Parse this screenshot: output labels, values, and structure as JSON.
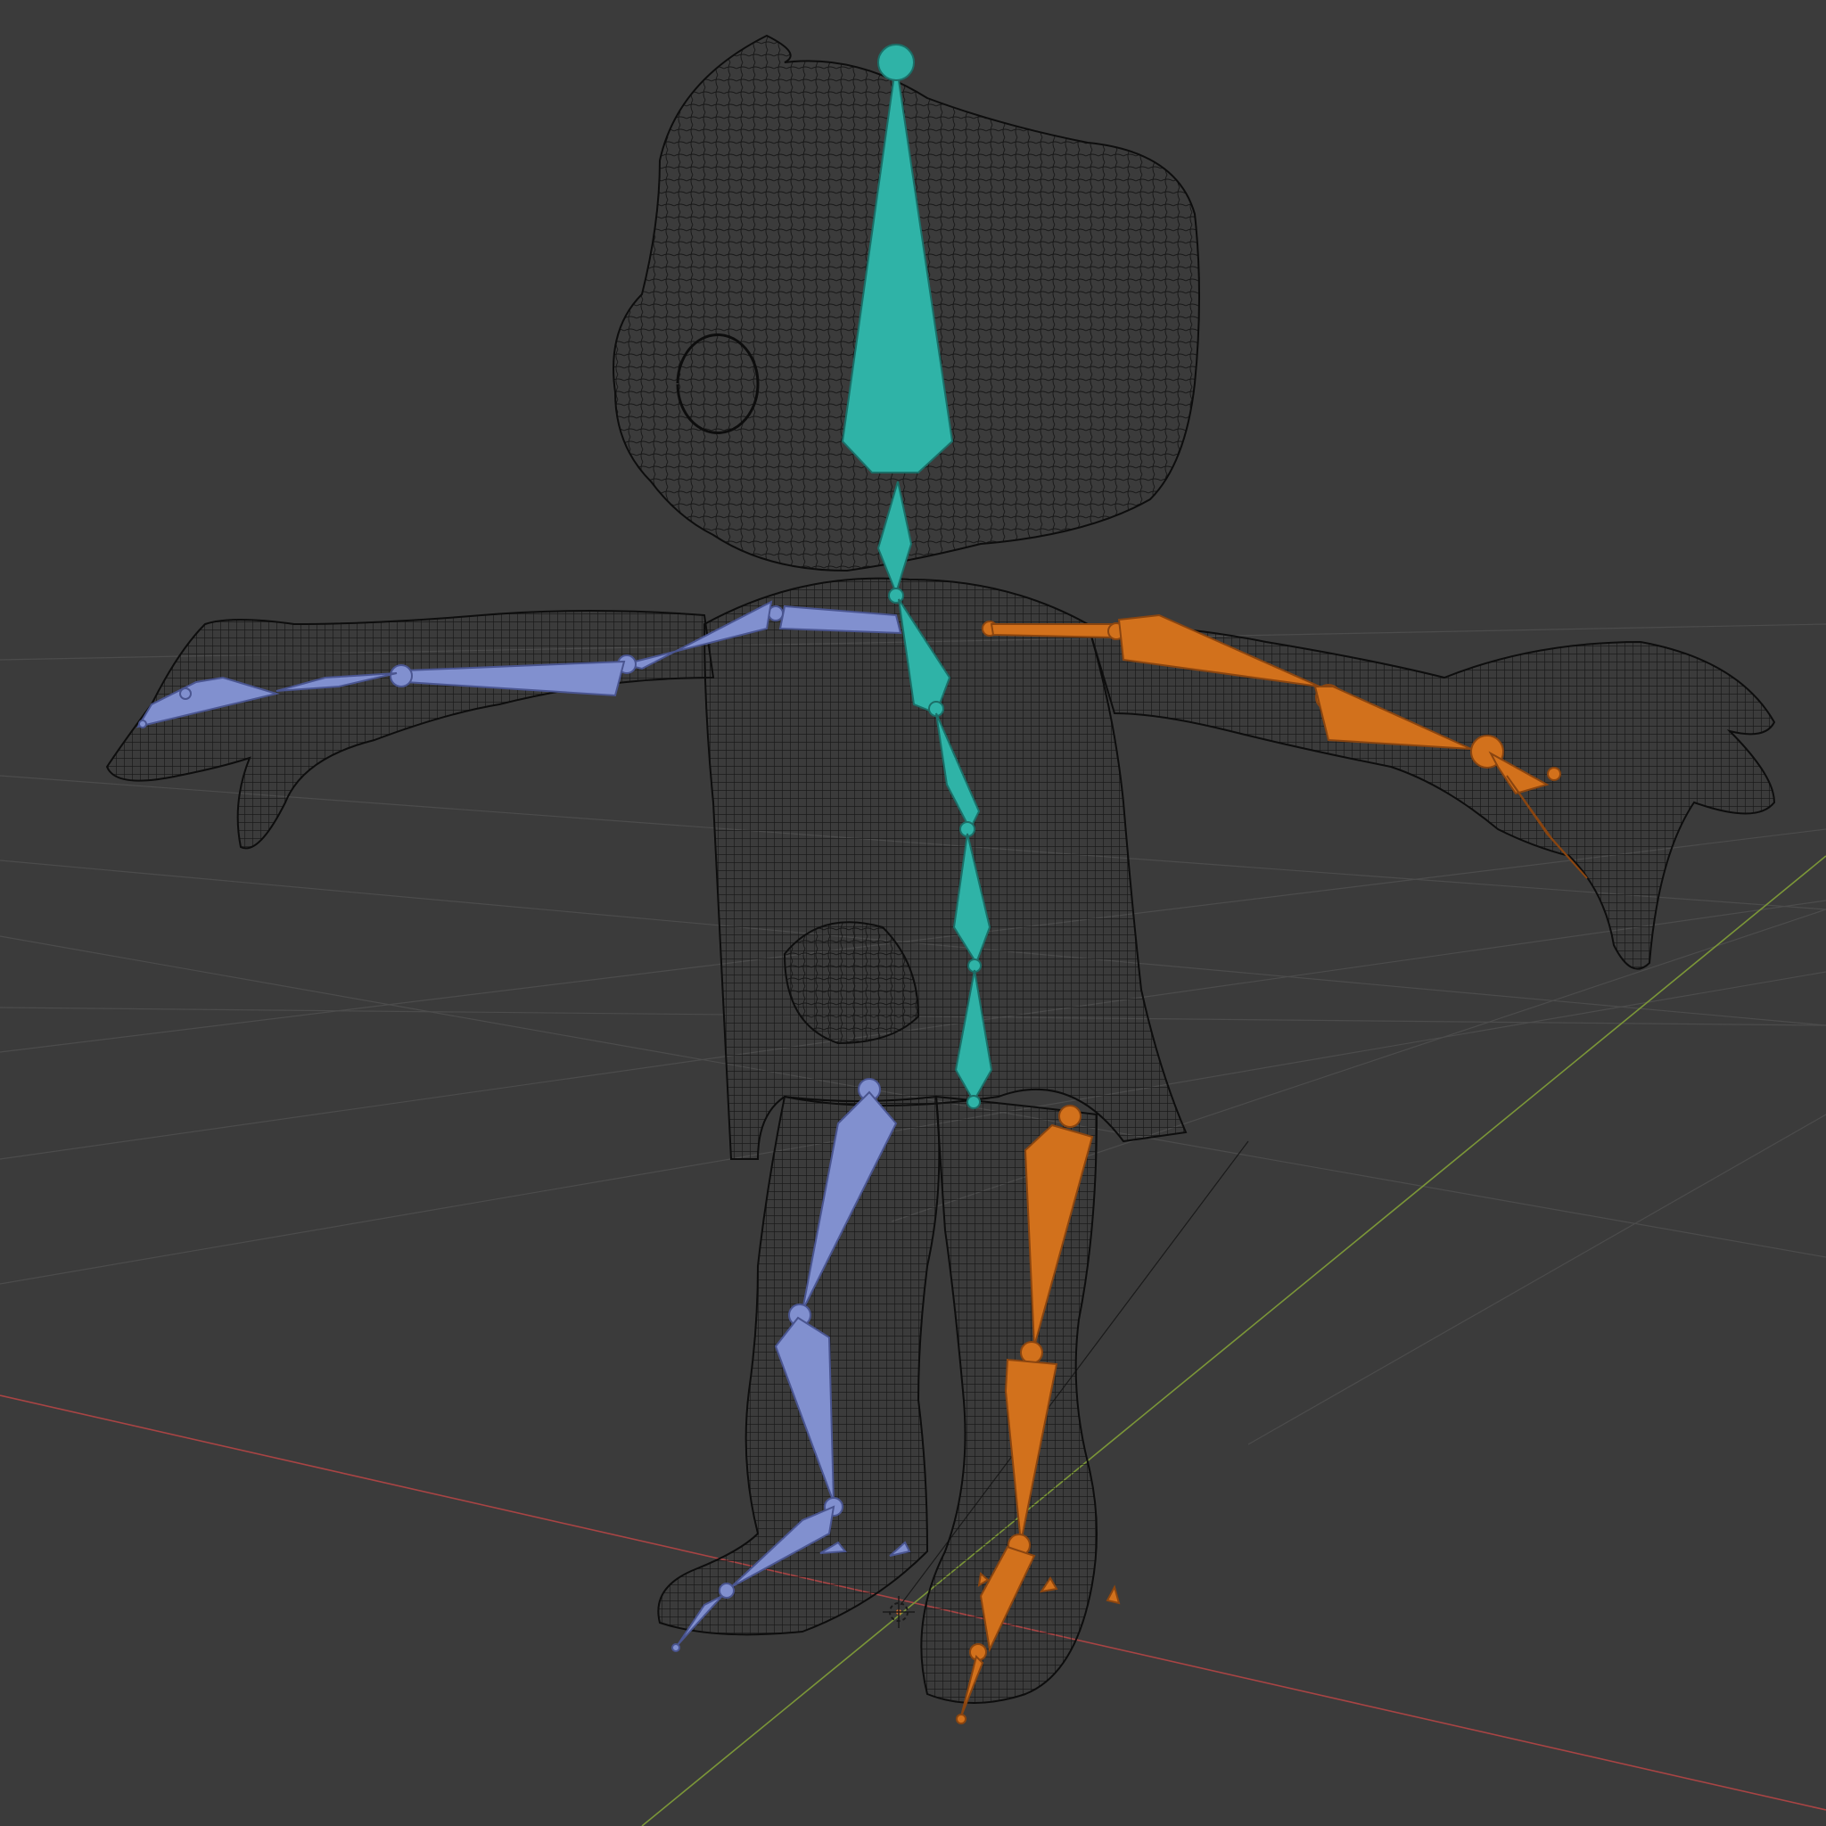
{
  "viewport": {
    "background_color": "#3b3b3b",
    "grid_color": "#4a4a4a",
    "x_axis_color": "#b34a4a",
    "y_axis_color": "#7f9a3a"
  },
  "mesh": {
    "display_mode": "wireframe",
    "wire_color": "#0f0f0f"
  },
  "armature": {
    "center_color": "#2fb3a7",
    "left_color": "#8190cf",
    "right_color": "#d2711c",
    "bones": {
      "head": "head-bone",
      "neck": "neck-bone",
      "spine": [
        "spine-upper-bone",
        "spine-mid-bone",
        "spine-lower-bone",
        "hips-bone"
      ],
      "left_arm": [
        "shoulder-l-bone",
        "upper-arm-l-bone",
        "forearm-l-bone",
        "hand-l-bone"
      ],
      "right_arm": [
        "shoulder-r-bone",
        "upper-arm-r-bone",
        "forearm-r-bone",
        "hand-r-bone"
      ],
      "left_leg": [
        "thigh-l-bone",
        "shin-l-bone",
        "foot-l-bone",
        "toe-l-bone"
      ],
      "right_leg": [
        "thigh-r-bone",
        "shin-r-bone",
        "foot-r-bone",
        "toe-r-bone"
      ]
    }
  },
  "cursor_3d": {
    "icon": "3d-cursor-icon"
  }
}
